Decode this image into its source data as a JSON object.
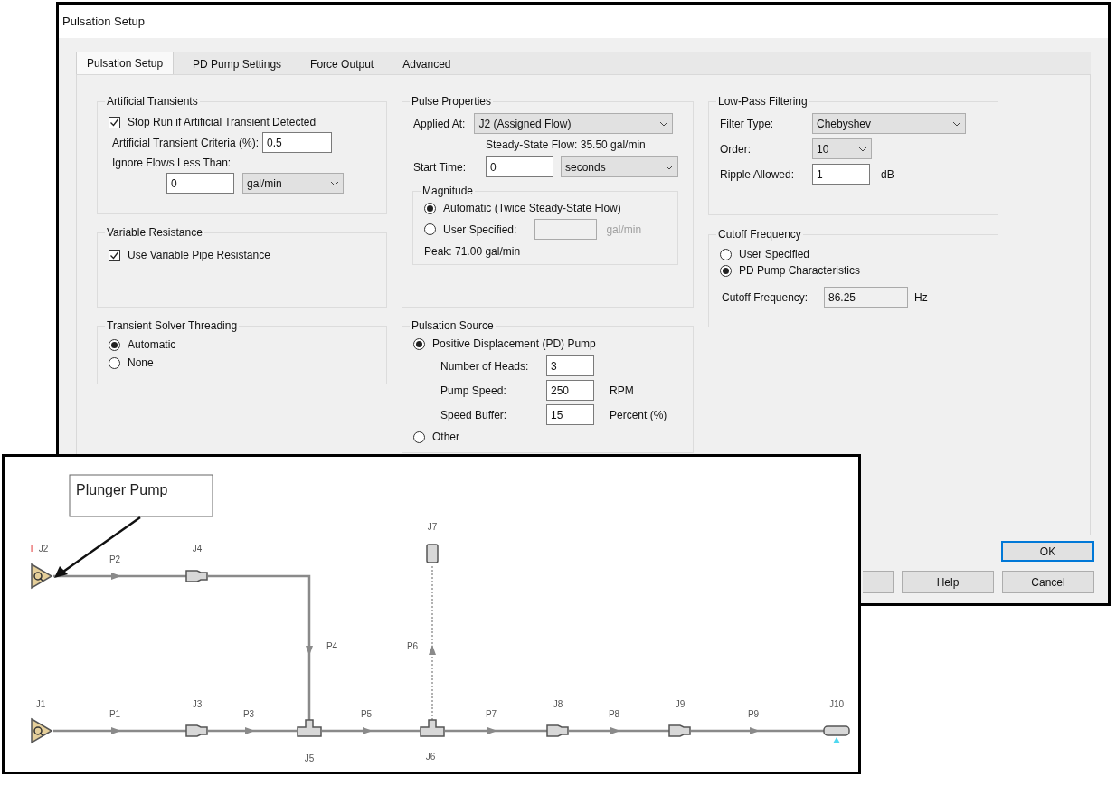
{
  "window": {
    "title": "Pulsation Setup"
  },
  "tabs": [
    {
      "label": "Pulsation Setup",
      "selected": true
    },
    {
      "label": "PD Pump Settings",
      "selected": false
    },
    {
      "label": "Force Output",
      "selected": false
    },
    {
      "label": "Advanced",
      "selected": false
    }
  ],
  "artificial_transients": {
    "title": "Artificial Transients",
    "stop_run": {
      "label": "Stop Run if Artificial Transient Detected",
      "checked": true
    },
    "criteria": {
      "label": "Artificial Transient Criteria (%):",
      "value": "0.5"
    },
    "ignore_flows": {
      "label": "Ignore Flows Less Than:",
      "value": "0",
      "unit": "gal/min"
    }
  },
  "variable_resistance": {
    "title": "Variable Resistance",
    "use_variable": {
      "label": "Use Variable Pipe Resistance",
      "checked": true
    }
  },
  "threading": {
    "title": "Transient Solver Threading",
    "options": [
      {
        "label": "Automatic",
        "selected": true
      },
      {
        "label": "None",
        "selected": false
      }
    ]
  },
  "pulse_properties": {
    "title": "Pulse Properties",
    "applied_at": {
      "label": "Applied At:",
      "value": "J2 (Assigned Flow)"
    },
    "steady_state": "Steady-State Flow: 35.50 gal/min",
    "start_time": {
      "label": "Start Time:",
      "value": "0",
      "unit": "seconds"
    },
    "magnitude": {
      "title": "Magnitude",
      "options": [
        {
          "label": "Automatic (Twice Steady-State Flow)",
          "selected": true
        },
        {
          "label": "User Specified:",
          "selected": false
        }
      ],
      "user_field": {
        "unit": "gal/min",
        "disabled": true
      },
      "peak": "Peak: 71.00 gal/min"
    }
  },
  "pulsation_source": {
    "title": "Pulsation Source",
    "options": [
      {
        "label": "Positive Displacement (PD) Pump",
        "selected": true
      },
      {
        "label": "Other",
        "selected": false
      }
    ],
    "fields": [
      {
        "label": "Number of Heads:",
        "value": "3"
      },
      {
        "label": "Pump Speed:",
        "value": "250",
        "unit": "RPM"
      },
      {
        "label": "Speed Buffer:",
        "value": "15",
        "unit": "Percent (%)"
      }
    ]
  },
  "low_pass": {
    "title": "Low-Pass Filtering",
    "filter_type": {
      "label": "Filter Type:",
      "value": "Chebyshev"
    },
    "order": {
      "label": "Order:",
      "value": "10"
    },
    "ripple": {
      "label": "Ripple Allowed:",
      "value": "1",
      "unit": "dB"
    }
  },
  "cutoff": {
    "title": "Cutoff Frequency",
    "options": [
      {
        "label": "User Specified",
        "selected": false
      },
      {
        "label": "PD Pump Characteristics",
        "selected": true
      }
    ],
    "frequency": {
      "label": "Cutoff Frequency:",
      "value": "86.25",
      "unit": "Hz",
      "disabled": true
    }
  },
  "buttons": [
    {
      "label": "OK",
      "default": true
    },
    {
      "label": "Help",
      "default": false
    },
    {
      "label": "Cancel",
      "default": false
    }
  ],
  "diagram": {
    "callout": "Plunger Pump",
    "nodes": [
      {
        "label": "J1",
        "kind": "source"
      },
      {
        "label": "J2",
        "kind": "source",
        "flag": "T"
      },
      {
        "label": "J3",
        "kind": "inline"
      },
      {
        "label": "J4",
        "kind": "inline"
      },
      {
        "label": "J5",
        "kind": "tee"
      },
      {
        "label": "J6",
        "kind": "tee"
      },
      {
        "label": "J7",
        "kind": "tank"
      },
      {
        "label": "J8",
        "kind": "inline"
      },
      {
        "label": "J9",
        "kind": "inline"
      },
      {
        "label": "J10",
        "kind": "outlet"
      }
    ],
    "pipes": [
      {
        "label": "P1",
        "kind": "solid"
      },
      {
        "label": "P2",
        "kind": "solid"
      },
      {
        "label": "P3",
        "kind": "solid"
      },
      {
        "label": "P4",
        "kind": "solid"
      },
      {
        "label": "P5",
        "kind": "solid"
      },
      {
        "label": "P6",
        "kind": "dotted"
      },
      {
        "label": "P7",
        "kind": "solid"
      },
      {
        "label": "P8",
        "kind": "solid"
      },
      {
        "label": "P9",
        "kind": "solid"
      }
    ]
  }
}
